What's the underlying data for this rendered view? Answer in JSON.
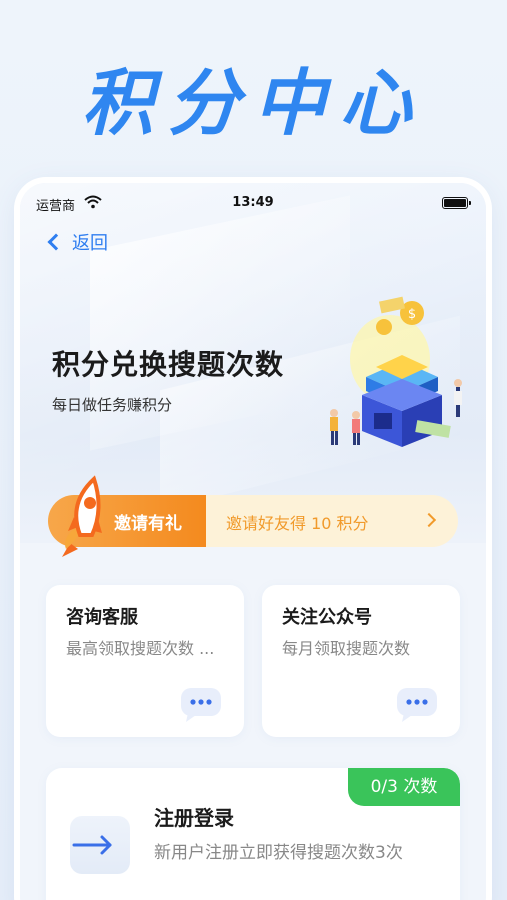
{
  "page": {
    "headline": "积分中心"
  },
  "status_bar": {
    "carrier": "运营商",
    "time": "13:49"
  },
  "nav": {
    "back_label": "返回"
  },
  "hero": {
    "title": "积分兑换搜题次数",
    "subtitle": "每日做任务赚积分"
  },
  "invite": {
    "tag": "邀请有礼",
    "text": "邀请好友得 10 积分"
  },
  "cards": [
    {
      "title": "咨询客服",
      "desc": "最高领取搜题次数 ...",
      "icon": "chat-bubble-icon"
    },
    {
      "title": "关注公众号",
      "desc": "每月领取搜题次数",
      "icon": "chat-bubble-icon"
    }
  ],
  "register": {
    "badge": "0/3 次数",
    "title": "注册登录",
    "desc": "新用户注册立即获得搜题次数3次",
    "icon": "arrow-right-icon"
  },
  "colors": {
    "accent_blue": "#2f7ef0",
    "headline_blue": "#2f86f0",
    "invite_orange": "#f48a1e",
    "badge_green": "#3ac45a"
  }
}
